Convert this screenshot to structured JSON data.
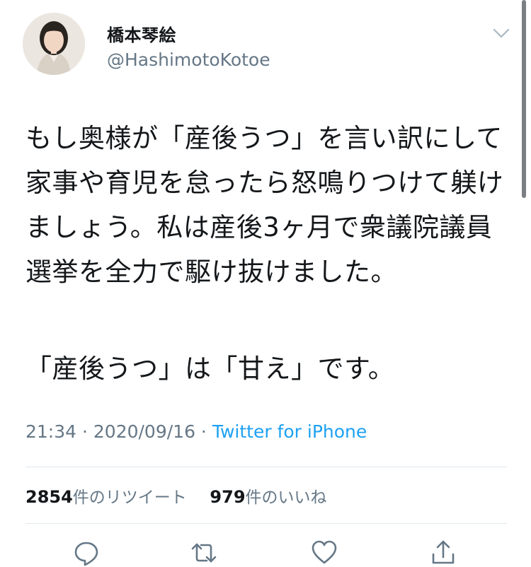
{
  "user": {
    "display_name": "橋本琴絵",
    "handle": "@HashimotoKotoe"
  },
  "tweet": {
    "paragraph1": "もし奥様が「産後うつ」を言い訳にして家事や育児を怠ったら怒鳴りつけて躾けましょう。私は産後3ヶ月で衆議院議員選挙を全力で駆け抜けました。",
    "paragraph2": "「産後うつ」は「甘え」です。"
  },
  "meta": {
    "time": "21:34",
    "separator1": " · ",
    "date": "2020/09/16",
    "separator2": " · ",
    "source": "Twitter for iPhone"
  },
  "stats": {
    "retweet_count": "2854",
    "retweet_label": "件のリツイート",
    "like_count": "979",
    "like_label": "件のいいね"
  },
  "icons": {
    "menu": "chevron-down-icon",
    "reply": "reply-icon",
    "retweet": "retweet-icon",
    "like": "heart-icon",
    "share": "share-icon"
  },
  "colors": {
    "link": "#1da1f2",
    "muted": "#657786",
    "text": "#14171a",
    "divider": "#e1e8ed"
  }
}
